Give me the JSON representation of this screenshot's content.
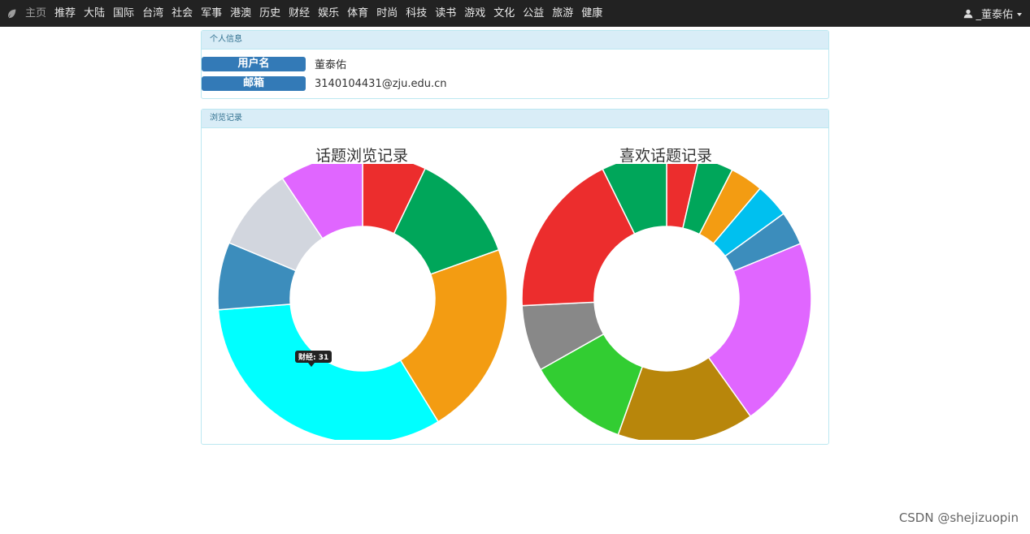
{
  "nav": {
    "items": [
      "主页",
      "推荐",
      "大陆",
      "国际",
      "台湾",
      "社会",
      "军事",
      "港澳",
      "历史",
      "财经",
      "娱乐",
      "体育",
      "时尚",
      "科技",
      "读书",
      "游戏",
      "文化",
      "公益",
      "旅游",
      "健康"
    ],
    "user": "_董泰佑"
  },
  "profile": {
    "heading": "个人信息",
    "name_label": "用户名",
    "name_value": "董泰佑",
    "email_label": "邮箱",
    "email_value": "3140104431@zju.edu.cn"
  },
  "history": {
    "heading": "浏览记录",
    "tooltip": "财经: 31"
  },
  "watermark": "CSDN @shejizuopin",
  "chart_data": [
    {
      "type": "pie",
      "title": "话题浏览记录",
      "slices": [
        {
          "color": "#ec2d2d",
          "value": 6.8
        },
        {
          "color": "#00a65a",
          "value": 11.8
        },
        {
          "color": "#f39c12",
          "value": 20.7
        },
        {
          "color": "#00ffff",
          "value": 31.0
        },
        {
          "color": "#3c8dbc",
          "value": 7.2
        },
        {
          "color": "#d2d6de",
          "value": 8.9
        },
        {
          "color": "#e066ff",
          "value": 8.9
        }
      ]
    },
    {
      "type": "pie",
      "title": "喜欢话题记录",
      "slices": [
        {
          "color": "#ec2d2d",
          "value": 3.6
        },
        {
          "color": "#00a65a",
          "value": 3.9
        },
        {
          "color": "#f39c12",
          "value": 3.7
        },
        {
          "color": "#00c0ef",
          "value": 3.8
        },
        {
          "color": "#3c8dbc",
          "value": 3.8
        },
        {
          "color": "#e066ff",
          "value": 21.4
        },
        {
          "color": "#b8860b",
          "value": 15.3
        },
        {
          "color": "#32cd32",
          "value": 11.4
        },
        {
          "color": "#888888",
          "value": 7.4
        },
        {
          "color": "#ec2d2d",
          "value": 18.5
        },
        {
          "color": "#00a65a",
          "value": 7.3
        }
      ]
    }
  ]
}
